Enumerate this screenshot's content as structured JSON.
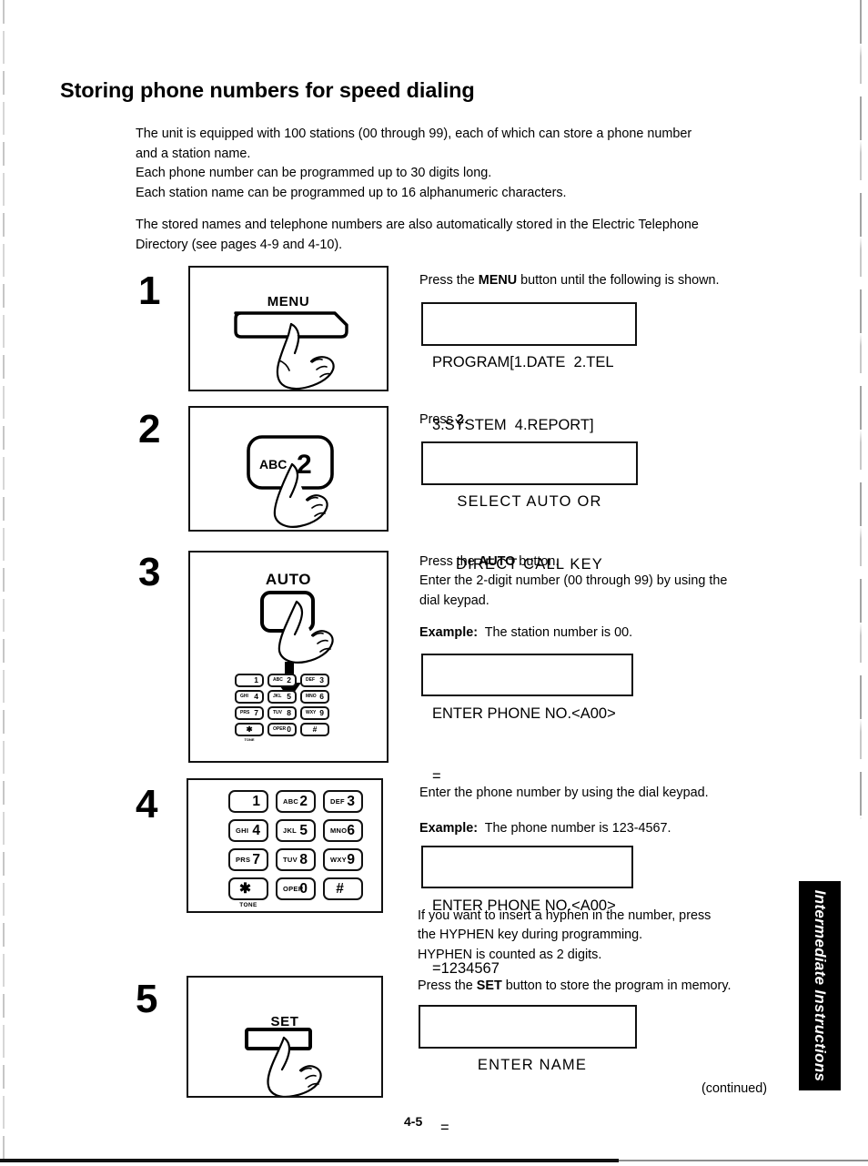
{
  "document": {
    "title": "Storing phone numbers for speed dialing",
    "page_number": "4-5",
    "continued_label": "(continued)",
    "side_tab_label": "Intermediate Instructions"
  },
  "intro": {
    "line1": "The unit is equipped with 100 stations (00 through 99), each of which can store a phone number",
    "line2": "and a station name.",
    "line3": "Each phone number can be programmed up to 30 digits long.",
    "line4": "Each station name can be programmed up to 16 alphanumeric characters.",
    "line5": "The stored names and telephone numbers are also automatically stored in the Electric Telephone",
    "line6": "Directory (see pages 4-9 and 4-10)."
  },
  "steps": [
    {
      "number": "1",
      "illustration_label": "MENU",
      "instruction_pre": "Press the ",
      "instruction_bold": "MENU",
      "instruction_post": " button until the following is shown.",
      "lcd": {
        "line1": "PROGRAM[1.DATE  2.TEL",
        "line2": "3.SYSTEM  4.REPORT]"
      }
    },
    {
      "number": "2",
      "key_alpha": "ABC",
      "key_digit": "2",
      "instruction_pre": "Press ",
      "instruction_bold": "2",
      "instruction_post": ".",
      "lcd": {
        "line1": "SELECT AUTO OR",
        "line2": "DIRECT CALL KEY"
      }
    },
    {
      "number": "3",
      "illustration_label": "AUTO",
      "instruction_line1_pre": "Press the ",
      "instruction_line1_bold": "AUTO",
      "instruction_line1_post": " button.",
      "instruction_line2": "Enter the 2-digit number (00 through 99) by using the",
      "instruction_line3": "dial keypad.",
      "example_label": "Example:",
      "example_text": "The station number is 00.",
      "lcd": {
        "line1": "ENTER PHONE NO.<A00>",
        "line2": "="
      }
    },
    {
      "number": "4",
      "instruction_line1": "Enter the phone number by using the dial keypad.",
      "example_label": "Example:",
      "example_text": "The phone number is 123-4567.",
      "lcd": {
        "line1": "ENTER PHONE NO.<A00>",
        "line2": "=1234567"
      },
      "note_line1": "If you want to insert a hyphen in the number, press",
      "note_line2": "the HYPHEN key during programming.",
      "note_line3": "HYPHEN is counted as 2 digits."
    },
    {
      "number": "5",
      "illustration_label": "SET",
      "instruction_pre": "Press the ",
      "instruction_bold": "SET",
      "instruction_post": " button to store the program in memory.",
      "lcd": {
        "line1": "ENTER NAME",
        "line2": "="
      }
    }
  ],
  "keypad": {
    "keys": [
      {
        "alpha": "",
        "digit": "1"
      },
      {
        "alpha": "ABC",
        "digit": "2"
      },
      {
        "alpha": "DEF",
        "digit": "3"
      },
      {
        "alpha": "GHI",
        "digit": "4"
      },
      {
        "alpha": "JKL",
        "digit": "5"
      },
      {
        "alpha": "MNO",
        "digit": "6"
      },
      {
        "alpha": "PRS",
        "digit": "7"
      },
      {
        "alpha": "TUV",
        "digit": "8"
      },
      {
        "alpha": "WXY",
        "digit": "9"
      },
      {
        "alpha": "",
        "digit": "✱",
        "sub": "TONE",
        "symbol": true
      },
      {
        "alpha": "OPER",
        "digit": "0"
      },
      {
        "alpha": "",
        "digit": "#",
        "symbol": true
      }
    ]
  },
  "colors": {
    "ink": "#000000",
    "paper": "#ffffff",
    "tab_background": "#000000",
    "tab_text": "#ffffff"
  }
}
